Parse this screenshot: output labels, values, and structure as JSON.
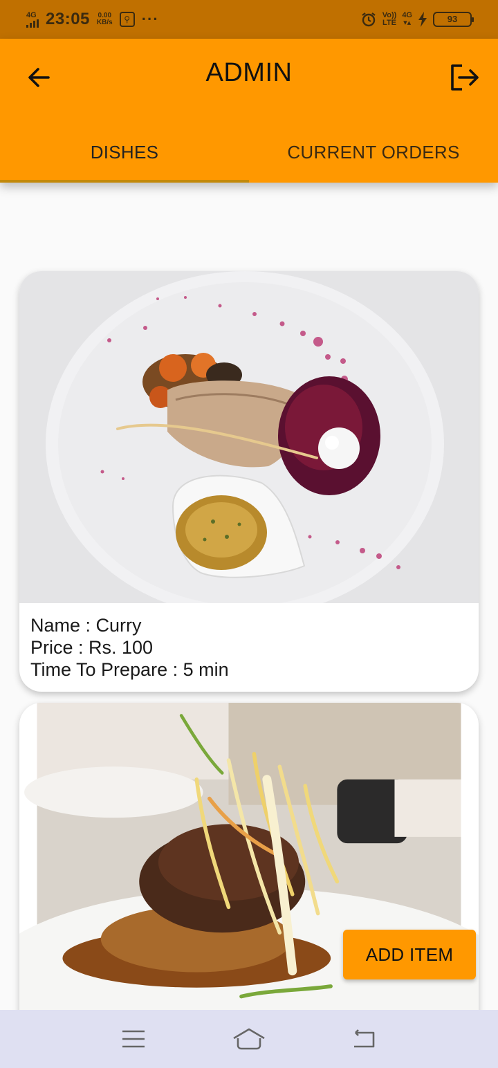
{
  "status_bar": {
    "network_label": "4G",
    "time": "23:05",
    "speed_value": "0.00",
    "speed_unit": "KB/s",
    "volte_top": "Vo))",
    "volte_bottom": "LTE",
    "network_right": "4G",
    "battery": "93"
  },
  "app_bar": {
    "title": "ADMIN",
    "tabs": [
      {
        "label": "DISHES",
        "selected": true
      },
      {
        "label": "CURRENT ORDERS",
        "selected": false
      }
    ]
  },
  "dishes": [
    {
      "name_line": "Name : Curry",
      "price_line": "Price : Rs. 100",
      "time_line": "Time To Prepare : 5 min",
      "image_icon": "plated-dish-image"
    },
    {
      "image_icon": "stacked-dish-image"
    }
  ],
  "fab": {
    "label": "ADD ITEM"
  },
  "colors": {
    "primary": "#ff9800",
    "status_bar": "#c07000",
    "nav_bar": "#dfe0f2"
  }
}
